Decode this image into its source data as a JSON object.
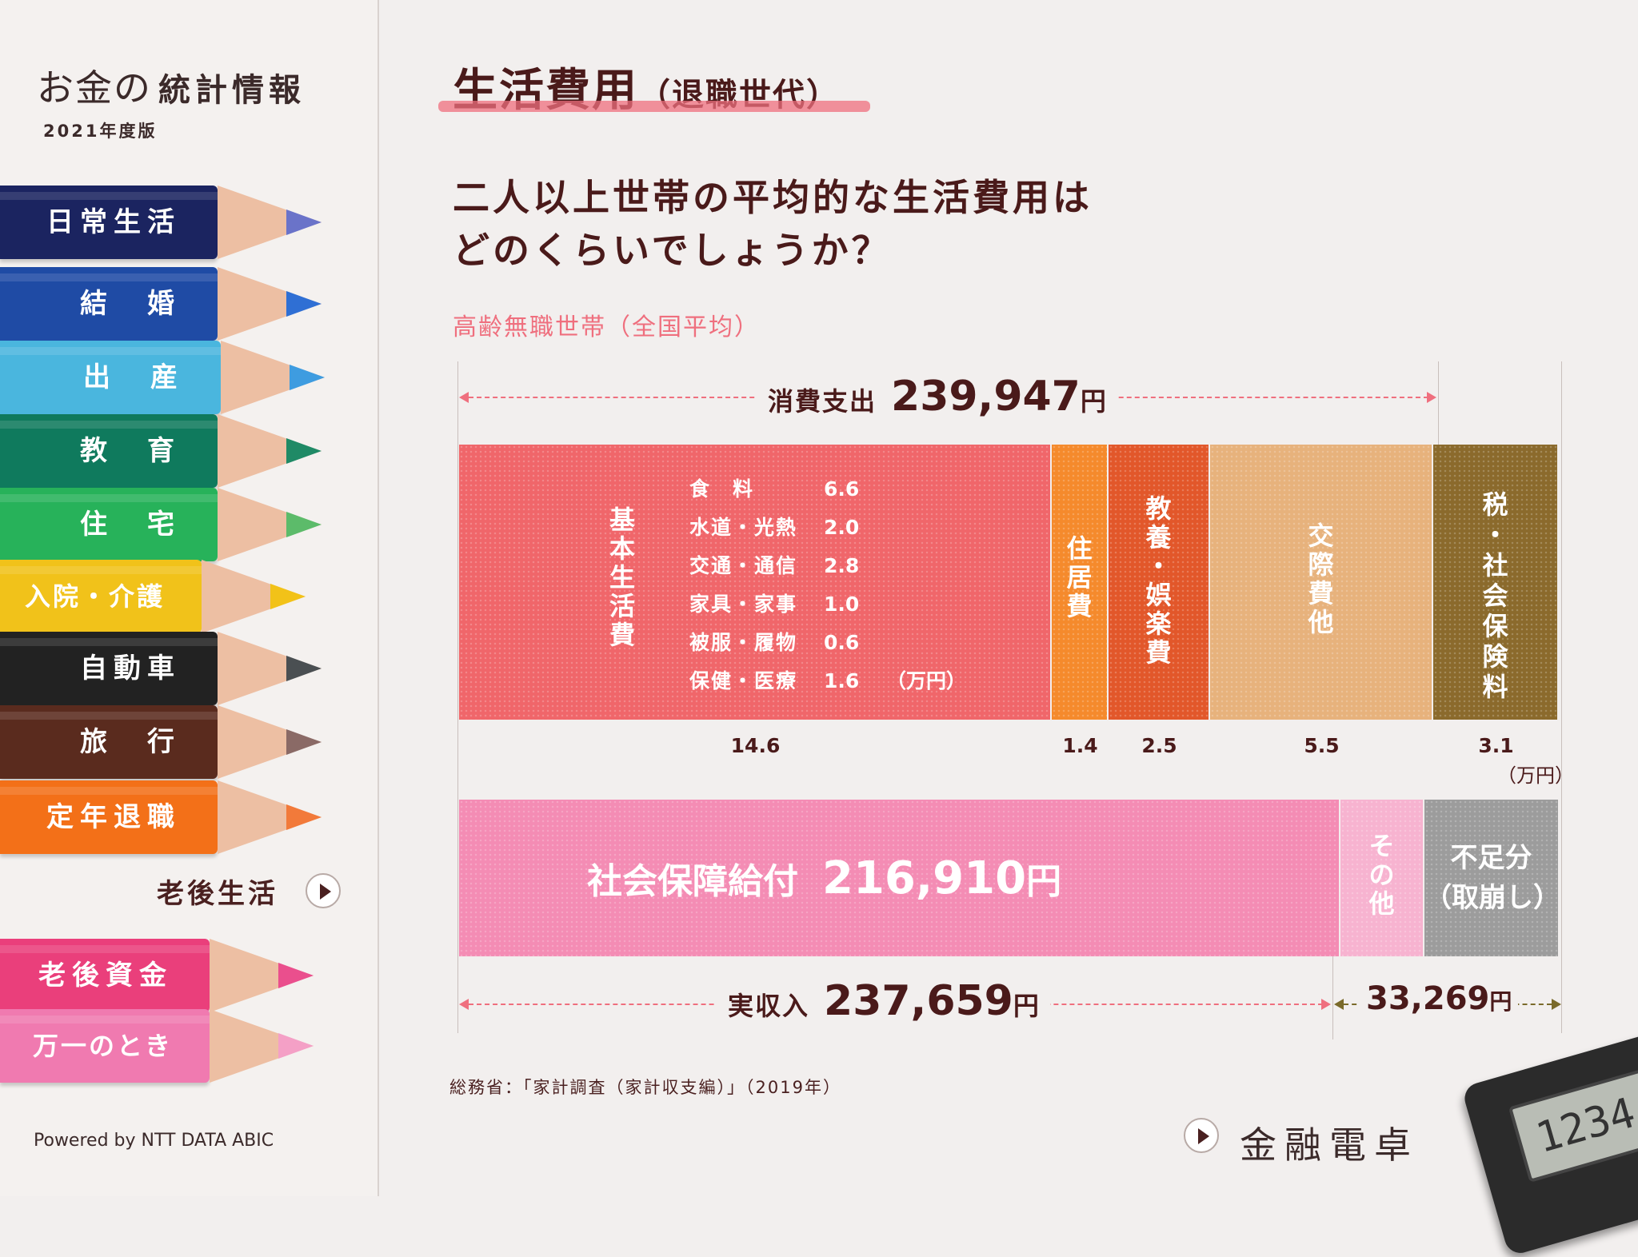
{
  "sidebar": {
    "brand_main": "お金の",
    "brand_main2": "統計情報",
    "brand_sub": "2021年度版",
    "menu": [
      {
        "label": "日常生活",
        "color": "#1b2460",
        "tip": "#6a73c9"
      },
      {
        "label": "結　婚",
        "color": "#1f4ba5",
        "tip": "#2f6fd4"
      },
      {
        "label": "出　産",
        "color": "#4ab6de",
        "tip": "#3e9ce0"
      },
      {
        "label": "教　育",
        "color": "#0f7a5d",
        "tip": "#1f8a66"
      },
      {
        "label": "住　宅",
        "color": "#27b25a",
        "tip": "#5cbb6a"
      },
      {
        "label": "入院・介護",
        "color": "#f1c21a",
        "tip": "#f2c218"
      },
      {
        "label": "自動車",
        "color": "#222222",
        "tip": "#4a4f52"
      },
      {
        "label": "旅　行",
        "color": "#5a2b1e",
        "tip": "#8a6a66"
      },
      {
        "label": "定年退職",
        "color": "#f37018",
        "tip": "#f27a3a"
      },
      {
        "label": "老後資金",
        "color": "#ea3f7b",
        "tip": "#ea4f8d"
      },
      {
        "label": "万一のとき",
        "color": "#f07ab0",
        "tip": "#f4a0c6"
      }
    ],
    "current": "老後生活",
    "powered": "Powered by NTT DATA ABIC"
  },
  "main": {
    "title": "生活費用",
    "title_sub": "（退職世代）",
    "question_line1": "二人以上世帯の平均的な生活費用は",
    "question_line2": "どのくらいでしょうか？",
    "subtitle": "高齢無職世帯（全国平均）",
    "spending_label": "消費支出",
    "spending_value": "239,947",
    "yen": "円",
    "unit_note": "（万円）",
    "income_label": "実収入",
    "income_value": "237,659",
    "shortfall_value": "33,269",
    "source": "総務省：「家計調査（家計収支編）」（2019年）",
    "calc_link": "金融電卓",
    "calc_display": "1234"
  },
  "chart_data": [
    {
      "type": "bar",
      "title": "消費支出 239,947円",
      "unit": "万円",
      "categories": [
        "基本生活費",
        "住居費",
        "教養・娯楽費",
        "交際費他",
        "税・社会保険料"
      ],
      "values": [
        14.6,
        1.4,
        2.5,
        5.5,
        3.1
      ],
      "value_labels": [
        "14.6",
        "1.4",
        "2.5",
        "5.5",
        "3.1"
      ],
      "colors": [
        "#f0666a",
        "#f58a2c",
        "#e2572a",
        "#e7b27c",
        "#8b6a2c"
      ],
      "breakdown": {
        "category": "基本生活費",
        "unit": "（万円）",
        "items": [
          {
            "name": "食　料",
            "value": "6.6"
          },
          {
            "name": "水道・光熱",
            "value": "2.0"
          },
          {
            "name": "交通・通信",
            "value": "2.8"
          },
          {
            "name": "家具・家事",
            "value": "1.0"
          },
          {
            "name": "被服・履物",
            "value": "0.6"
          },
          {
            "name": "保健・医療",
            "value": "1.6"
          }
        ]
      }
    },
    {
      "type": "bar",
      "title": "実収入 237,659円",
      "unit": "円",
      "segments": [
        {
          "label": "社会保障給付",
          "value": 216910,
          "display": "216,910",
          "color": "#f48cb4"
        },
        {
          "label": "その他",
          "value": 20749,
          "display": "",
          "color": "#f7b3d0"
        },
        {
          "label": "不足分（取崩し）",
          "value": 33269,
          "display": "33,269",
          "color": "#9c9c9c"
        }
      ],
      "shortfall_line1": "不足分",
      "shortfall_line2": "（取崩し）"
    }
  ]
}
